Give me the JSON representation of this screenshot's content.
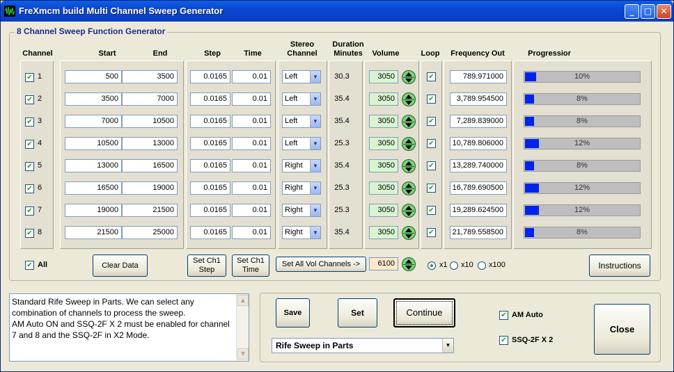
{
  "window": {
    "title": "FreXmcm build  Multi Channel Sweep Generator"
  },
  "group_title": "8 Channel Sweep Function Generator",
  "headers": {
    "channel": "Channel",
    "start": "Start",
    "end": "End",
    "step": "Step",
    "time": "Time",
    "stereo_line1": "Stereo",
    "stereo_line2": "Channel",
    "duration_line1": "Duration",
    "duration_line2": "Minutes",
    "volume": "Volume",
    "loop": "Loop",
    "freq_out": "Frequency Out",
    "progression": "Progressior"
  },
  "channels": [
    {
      "num": "1",
      "start": "500",
      "end": "3500",
      "step": "0.0165",
      "time": "0.01",
      "stereo": "Left",
      "duration": "30.3",
      "volume": "3050",
      "loop": true,
      "freq": "789.971000",
      "progress": 10,
      "progress_label": "10%"
    },
    {
      "num": "2",
      "start": "3500",
      "end": "7000",
      "step": "0.0165",
      "time": "0.01",
      "stereo": "Left",
      "duration": "35.4",
      "volume": "3050",
      "loop": true,
      "freq": "3,789.954500",
      "progress": 8,
      "progress_label": "8%"
    },
    {
      "num": "3",
      "start": "7000",
      "end": "10500",
      "step": "0.0165",
      "time": "0.01",
      "stereo": "Left",
      "duration": "35.4",
      "volume": "3050",
      "loop": true,
      "freq": "7,289.839000",
      "progress": 8,
      "progress_label": "8%"
    },
    {
      "num": "4",
      "start": "10500",
      "end": "13000",
      "step": "0.0165",
      "time": "0.01",
      "stereo": "Left",
      "duration": "25.3",
      "volume": "3050",
      "loop": true,
      "freq": "10,789.806000",
      "progress": 12,
      "progress_label": "12%"
    },
    {
      "num": "5",
      "start": "13000",
      "end": "16500",
      "step": "0.0165",
      "time": "0.01",
      "stereo": "Right",
      "duration": "35.4",
      "volume": "3050",
      "loop": true,
      "freq": "13,289.740000",
      "progress": 8,
      "progress_label": "8%"
    },
    {
      "num": "6",
      "start": "16500",
      "end": "19000",
      "step": "0.0165",
      "time": "0.01",
      "stereo": "Right",
      "duration": "25.3",
      "volume": "3050",
      "loop": true,
      "freq": "16,789.690500",
      "progress": 12,
      "progress_label": "12%"
    },
    {
      "num": "7",
      "start": "19000",
      "end": "21500",
      "step": "0.0165",
      "time": "0.01",
      "stereo": "Right",
      "duration": "25.3",
      "volume": "3050",
      "loop": true,
      "freq": "19,289.624500",
      "progress": 12,
      "progress_label": "12%"
    },
    {
      "num": "8",
      "start": "21500",
      "end": "25000",
      "step": "0.0165",
      "time": "0.01",
      "stereo": "Right",
      "duration": "35.4",
      "volume": "3050",
      "loop": true,
      "freq": "21,789.558500",
      "progress": 8,
      "progress_label": "8%"
    }
  ],
  "controls": {
    "all_label": "All",
    "clear_data": "Clear Data",
    "set_ch1_step_line1": "Set Ch1",
    "set_ch1_step_line2": "Step",
    "set_ch1_time_line1": "Set Ch1",
    "set_ch1_time_line2": "Time",
    "set_all_vol": "Set All Vol Channels ->",
    "all_vol_value": "6100",
    "x1": "x1",
    "x10": "x10",
    "x100": "x100",
    "instructions": "Instructions"
  },
  "description": "Standard Rife Sweep in Parts. We can select any combination of channels to process the sweep.\nAM Auto ON and SSQ-2F X 2 must be enabled for channel 7 and 8 and the SSQ-2F in X2 Mode.",
  "bottom": {
    "save": "Save",
    "set": "Set",
    "continue": "Continue",
    "preset": "Rife Sweep in Parts",
    "am_auto": "AM Auto",
    "ssq": "SSQ-2F  X  2",
    "close": "Close"
  },
  "colors": {
    "progress_fill": "#0024e8",
    "volume_bg": "#d8f5d0",
    "titlebar": "#0a46d2"
  }
}
